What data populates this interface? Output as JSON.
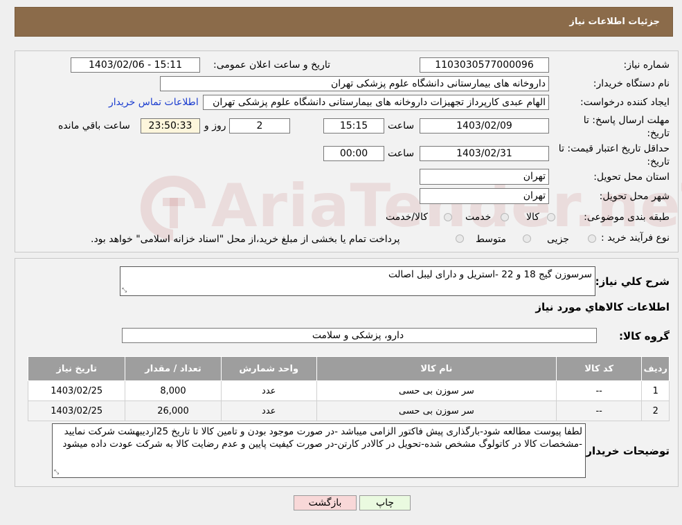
{
  "header": {
    "title": "جزئیات اطلاعات نیاز"
  },
  "form": {
    "need_number_label": "شماره نیاز:",
    "need_number": "1103030577000096",
    "announce_label": "تاریخ و ساعت اعلان عمومی:",
    "announce_value": "1403/02/06 - 15:11",
    "buyer_org_label": "نام دستگاه خریدار:",
    "buyer_org": "داروخانه های بیمارستانی دانشگاه علوم پزشکی تهران",
    "requester_label": "ایجاد کننده درخواست:",
    "requester": "الهام عبدی کارپرداز تجهیزات داروخانه های بیمارستانی دانشگاه علوم پزشکی تهران",
    "contact_link": "اطلاعات تماس خریدار",
    "reply_deadline_label": "مهلت ارسال پاسخ: تا تاریخ:",
    "reply_date": "1403/02/09",
    "time_label": "ساعت",
    "reply_time": "15:15",
    "days_value": "2",
    "days_label": "روز و",
    "remaining_time": "23:50:33",
    "remaining_label": "ساعت باقي مانده",
    "price_validity_label": "حداقل تاریخ اعتبار قیمت: تا تاریخ:",
    "price_date": "1403/02/31",
    "price_time": "00:00",
    "province_label": "استان محل تحویل:",
    "province": "تهران",
    "city_label": "شهر محل تحویل:",
    "city": "تهران",
    "category_label": "طبقه بندی موضوعی:",
    "category_options": [
      "کالا",
      "خدمت",
      "کالا/خدمت"
    ],
    "process_label": "نوع فرآیند خرید :",
    "process_options": [
      "جزیی",
      "متوسط"
    ],
    "process_note": "پرداخت تمام یا بخشی از مبلغ خرید،از محل \"اسناد خزانه اسلامی\" خواهد بود."
  },
  "watermark": {
    "text": "AriaTender.neT"
  },
  "details": {
    "summary_label": "شرح کلي نیاز:",
    "summary": "سرسوزن گیج 18 و 22 -استریل و دارای لیبل اصالت",
    "goods_info_title": "اطلاعات کالاهاي مورد نیاز",
    "goods_group_label": "گروه کالا:",
    "goods_group": "دارو، پزشکی و سلامت"
  },
  "table": {
    "headers": [
      "ردیف",
      "کد کالا",
      "نام کالا",
      "واحد شمارش",
      "تعداد / مقدار",
      "تاریخ نیاز"
    ],
    "rows": [
      [
        "1",
        "--",
        "سر سوزن بی حسی",
        "عدد",
        "8,000",
        "1403/02/25"
      ],
      [
        "2",
        "--",
        "سر سوزن بی حسی",
        "عدد",
        "26,000",
        "1403/02/25"
      ]
    ]
  },
  "notes": {
    "label": "توضیحات خریدار:",
    "text": "لطفا پیوست مطالعه شود-بارگذاری پیش فاکتور الزامی میباشد -در صورت موجود بودن و تامین کالا تا تاریخ 25اردیبهشت شرکت نمایید -مشخصات کالا در کاتولوگ مشخص شده-تحویل در کالادر کارتن-در صورت کیفیت پایین و عدم رضایت کالا به شرکت عودت داده میشود"
  },
  "buttons": {
    "print": "چاپ",
    "back": "بازگشت"
  },
  "colors": {
    "header_bg": "#8b6b4a",
    "table_header": "#9e9e9e",
    "back_button": "#f8d8d8",
    "print_button": "#eafae0",
    "link": "#1a3ccf"
  }
}
